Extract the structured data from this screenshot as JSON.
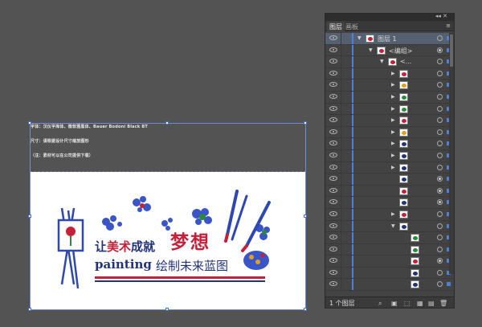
{
  "artboard_notes": {
    "line1": "字体：汉仪字库体、微软雅黑体、Bauer Bodoni Black BT",
    "line2": "尺寸：请根据设计尺寸缩放图形",
    "line3": "（注：素材可以在公司提供下载）"
  },
  "artwork": {
    "line1_prefix": "让",
    "line1_highlight": "美术",
    "line1_suffix": "成就",
    "dream": "梦想",
    "line2_latin": "painting",
    "line2_cn": "绘制未来蓝图"
  },
  "panel": {
    "collapse_glyph": "◂◂  ✕",
    "tab_active": "图层",
    "tab_inactive": "画板",
    "menu_glyph": "≡",
    "rows": [
      {
        "indent": 0,
        "arrow": "▼",
        "label": "图层 1",
        "selected": true,
        "thumb": "#c4203a",
        "target_filled": false
      },
      {
        "indent": 1,
        "arrow": "▼",
        "label": "<编组>",
        "selected": false,
        "thumb": "#c4203a",
        "target_filled": true
      },
      {
        "indent": 2,
        "arrow": "▼",
        "label": "<...",
        "selected": false,
        "thumb": "#c4203a",
        "target_filled": false
      },
      {
        "indent": 3,
        "arrow": "▶",
        "label": "",
        "selected": false,
        "thumb": "#c4203a",
        "target_filled": false
      },
      {
        "indent": 3,
        "arrow": "▶",
        "label": "",
        "selected": false,
        "thumb": "#e0a020",
        "target_filled": false
      },
      {
        "indent": 3,
        "arrow": "▶",
        "label": "",
        "selected": false,
        "thumb": "#2a8a3a",
        "target_filled": false
      },
      {
        "indent": 3,
        "arrow": "▶",
        "label": "",
        "selected": false,
        "thumb": "#2a8a3a",
        "target_filled": false
      },
      {
        "indent": 3,
        "arrow": "▶",
        "label": "",
        "selected": false,
        "thumb": "#c4203a",
        "target_filled": false
      },
      {
        "indent": 3,
        "arrow": "▶",
        "label": "",
        "selected": false,
        "thumb": "#e0a020",
        "target_filled": false
      },
      {
        "indent": 3,
        "arrow": "▶",
        "label": "",
        "selected": false,
        "thumb": "#23337a",
        "target_filled": false
      },
      {
        "indent": 3,
        "arrow": "▶",
        "label": "",
        "selected": false,
        "thumb": "#23337a",
        "target_filled": false
      },
      {
        "indent": 3,
        "arrow": "▶",
        "label": "",
        "selected": false,
        "thumb": "#23337a",
        "target_filled": false
      },
      {
        "indent": 3,
        "arrow": "",
        "label": "",
        "selected": false,
        "thumb": "#23337a",
        "target_filled": true
      },
      {
        "indent": 3,
        "arrow": "",
        "label": "",
        "selected": false,
        "thumb": "#c4203a",
        "target_filled": true
      },
      {
        "indent": 3,
        "arrow": "",
        "label": "",
        "selected": false,
        "thumb": "#23337a",
        "target_filled": true
      },
      {
        "indent": 3,
        "arrow": "▶",
        "label": "",
        "selected": false,
        "thumb": "#c4203a",
        "target_filled": false
      },
      {
        "indent": 3,
        "arrow": "▼",
        "label": "",
        "selected": false,
        "thumb": "#23337a",
        "target_filled": false
      },
      {
        "indent": 4,
        "arrow": "",
        "label": "",
        "selected": false,
        "thumb": "#2a8a3a",
        "target_filled": false
      },
      {
        "indent": 4,
        "arrow": "",
        "label": "",
        "selected": false,
        "thumb": "#2a8a3a",
        "target_filled": false
      },
      {
        "indent": 4,
        "arrow": "",
        "label": "",
        "selected": false,
        "thumb": "#c4203a",
        "target_filled": true
      },
      {
        "indent": 4,
        "arrow": "",
        "label": "",
        "selected": false,
        "thumb": "#23337a",
        "target_filled": false
      },
      {
        "indent": 4,
        "arrow": "",
        "label": "",
        "selected": false,
        "thumb": "#23337a",
        "target_filled": false
      }
    ],
    "footer_label": "1 个图层",
    "footer_icons": [
      "⌕",
      "▣",
      "⬚",
      "▦",
      "▤",
      "🗑"
    ]
  },
  "colors": {
    "accent": "#4f7fd8",
    "red": "#c4203a",
    "navy": "#23337a"
  }
}
